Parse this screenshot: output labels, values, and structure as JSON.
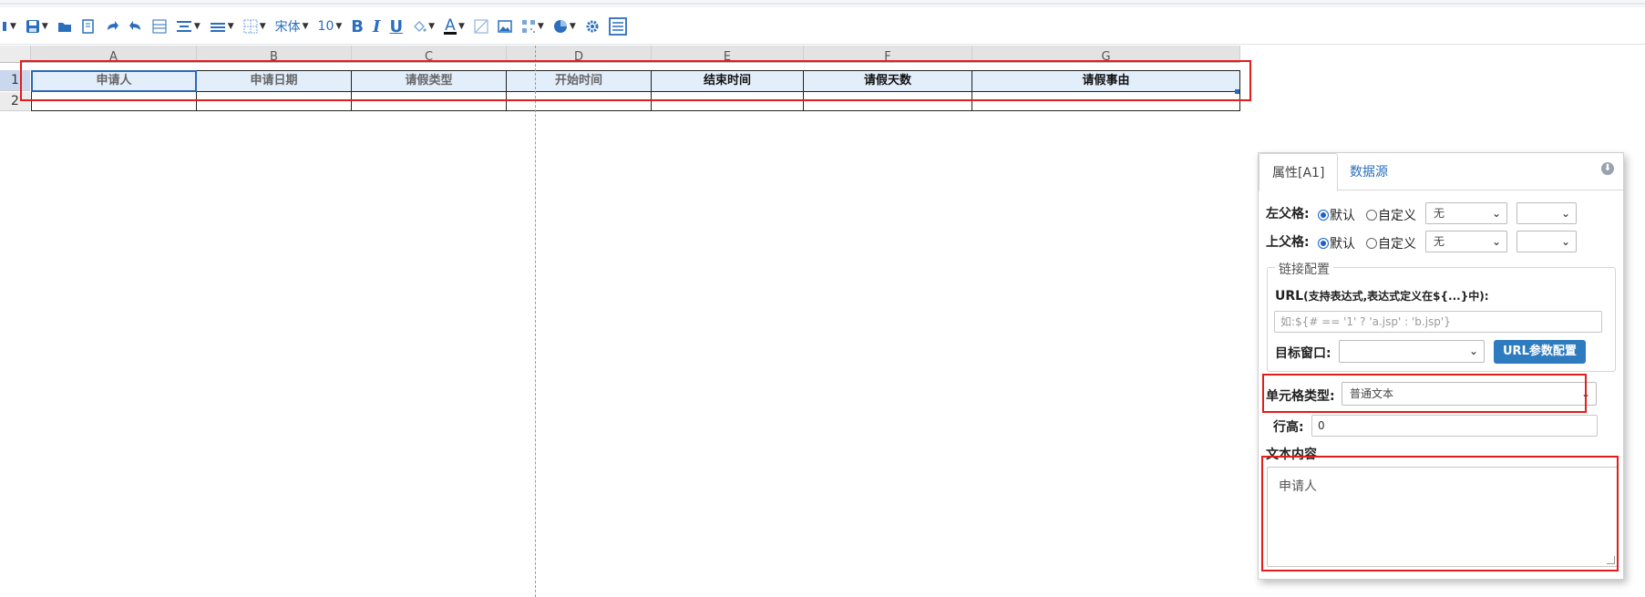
{
  "toolbar": {
    "font_name": "宋体",
    "font_size": "10",
    "bold": "B",
    "italic": "I",
    "underline": "U",
    "font_color_letter": "A"
  },
  "sheet": {
    "columns": [
      "A",
      "B",
      "C",
      "D",
      "E",
      "F",
      "G"
    ],
    "rows": [
      "1",
      "2"
    ],
    "row1": [
      "申请人",
      "申请日期",
      "请假类型",
      "开始时间",
      "结束时间",
      "请假天数",
      "请假事由"
    ]
  },
  "panel": {
    "tab_properties": "属性[A1]",
    "tab_datasource": "数据源",
    "left_parent_label": "左父格:",
    "top_parent_label": "上父格:",
    "radio_default": "默认",
    "radio_custom": "自定义",
    "none_option": "无",
    "link_config_legend": "链接配置",
    "url_label": "URL",
    "url_hint": "(支持表达式,表达式定义在${...}中):",
    "url_placeholder": "如:${# == '1' ? 'a.jsp' : 'b.jsp'}",
    "target_window_label": "目标窗口:",
    "url_param_button": "URL参数配置",
    "cell_type_label": "单元格类型:",
    "cell_type_value": "普通文本",
    "row_height_label": "行高:",
    "row_height_value": "0",
    "text_content_label": "文本内容",
    "text_content_value": "申请人"
  }
}
